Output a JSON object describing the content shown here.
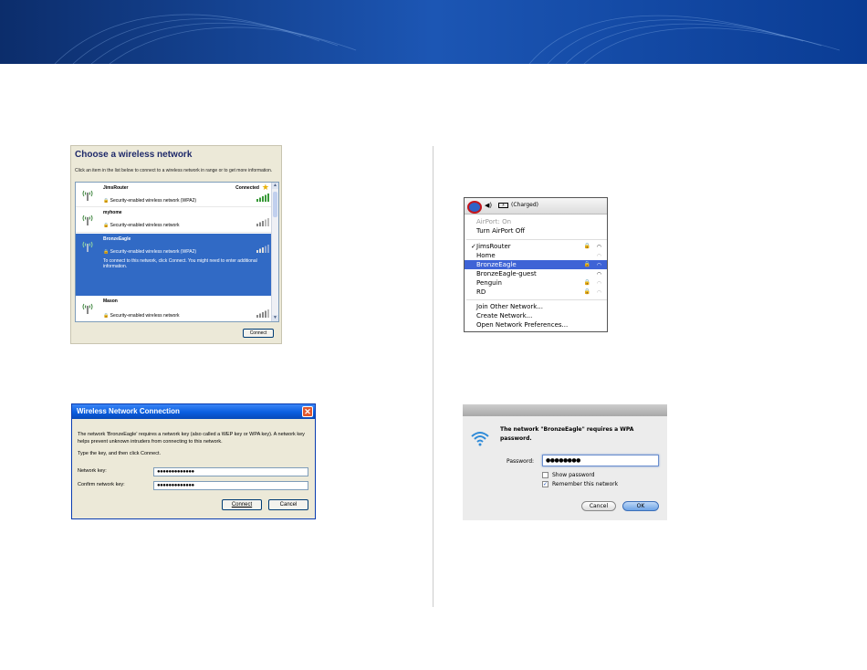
{
  "xp_choose": {
    "title": "Choose a wireless network",
    "description": "Click an item in the list below to connect to a wireless network in range or to get more information.",
    "networks": [
      {
        "name": "JimsRouter",
        "security": "Security-enabled wireless network (WPA2)",
        "status": "Connected"
      },
      {
        "name": "myhome",
        "security": "Security-enabled wireless network"
      },
      {
        "name": "BronzeEagle",
        "security": "Security-enabled wireless network (WPA2)",
        "hint": "To connect to this network, click Connect. You might need to enter additional information."
      },
      {
        "name": "Mason",
        "security": "Security-enabled wireless network"
      }
    ],
    "connect_label": "Connect"
  },
  "xp_key": {
    "title": "Wireless Network Connection",
    "message": "The network 'BronzeEagle' requires a network key (also called a WEP key or WPA key). A network key helps prevent unknown intruders from connecting to this network.",
    "instruction": "Type the key, and then click Connect.",
    "key_label": "Network key:",
    "key_value": "●●●●●●●●●●●●●",
    "confirm_label": "Confirm network key:",
    "confirm_value": "●●●●●●●●●●●●●",
    "connect_label": "Connect",
    "cancel_label": "Cancel"
  },
  "mac_menu": {
    "battery_text": "(Charged)",
    "airport_status": "AirPort: On",
    "turn_off": "Turn AirPort Off",
    "networks": [
      {
        "name": "JimsRouter",
        "checked": true,
        "locked": true
      },
      {
        "name": "Home",
        "locked": false
      },
      {
        "name": "BronzeEagle",
        "locked": true,
        "selected": true
      },
      {
        "name": "BronzeEagle-guest",
        "locked": false
      },
      {
        "name": "Penguin",
        "locked": true
      },
      {
        "name": "RD",
        "locked": true
      }
    ],
    "join_other": "Join Other Network...",
    "create": "Create Network...",
    "open_prefs": "Open Network Preferences..."
  },
  "mac_password": {
    "message": "The network \"BronzeEagle\" requires a WPA password.",
    "password_label": "Password:",
    "password_value": "●●●●●●●●",
    "show_password": "Show password",
    "remember": "Remember this network",
    "remember_checked": true,
    "cancel_label": "Cancel",
    "ok_label": "OK"
  }
}
